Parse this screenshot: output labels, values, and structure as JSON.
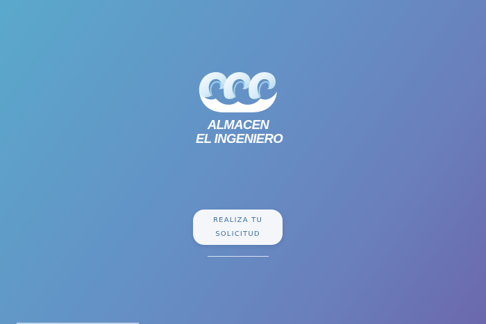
{
  "brand": {
    "logo_icon": "waves-logo-icon",
    "name_line1": "ALMACEN",
    "name_line2": "EL INGENIERO"
  },
  "cta": {
    "line1": "REALIZA TU",
    "line2": "SOLICITUD"
  },
  "colors": {
    "background_start": "#5aa9cb",
    "background_end": "#6b68ad",
    "button_bg": "#f4f6fa",
    "button_text": "#3b6f9e"
  }
}
